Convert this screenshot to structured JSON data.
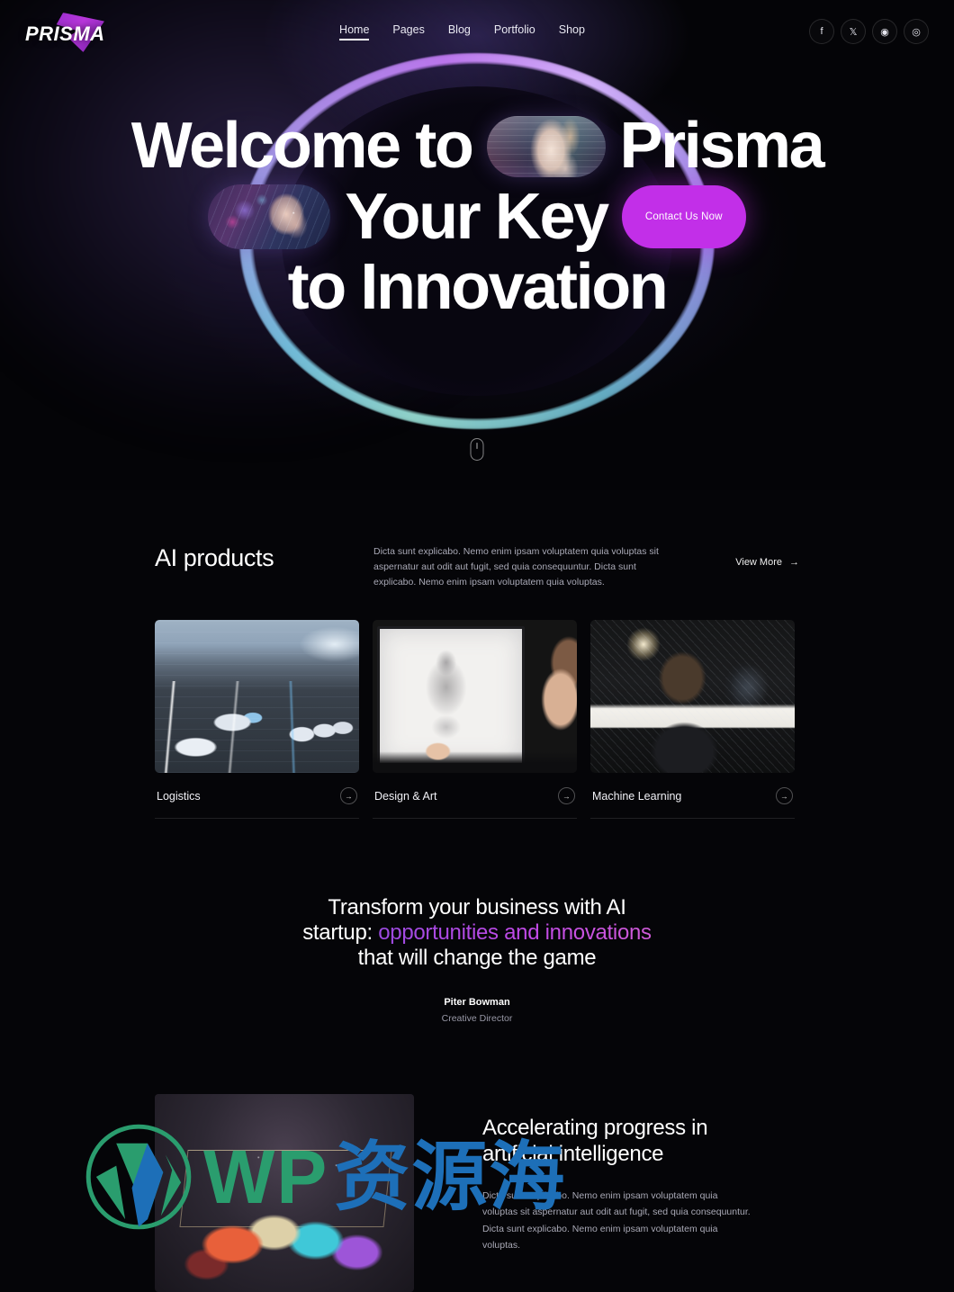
{
  "header": {
    "logo_text": "PRISMA",
    "nav": [
      {
        "label": "Home",
        "active": true
      },
      {
        "label": "Pages",
        "active": false
      },
      {
        "label": "Blog",
        "active": false
      },
      {
        "label": "Portfolio",
        "active": false
      },
      {
        "label": "Shop",
        "active": false
      }
    ],
    "socials": [
      {
        "name": "facebook-icon",
        "glyph": "f"
      },
      {
        "name": "x-twitter-icon",
        "glyph": "𝕏"
      },
      {
        "name": "dribbble-icon",
        "glyph": "◉"
      },
      {
        "name": "instagram-icon",
        "glyph": "◎"
      }
    ]
  },
  "hero": {
    "line1_a": "Welcome to",
    "line1_b": "Prisma",
    "line2": "Your Key",
    "line3": "to Innovation",
    "cta_label": "Contact Us Now",
    "cta_color": "#c22fe8",
    "image_1": "hand-glitch-image",
    "image_2": "cyborg-woman-image",
    "scroll_indicator": "mouse-scroll-icon"
  },
  "products": {
    "title": "AI products",
    "description": "Dicta sunt explicabo. Nemo enim ipsam voluptatem quia voluptas sit aspernatur aut odit aut fugit, sed quia consequuntur. Dicta sunt explicabo. Nemo enim ipsam voluptatem quia voluptas.",
    "view_more_label": "View More",
    "cards": [
      {
        "label": "Logistics",
        "image": "warehouse-trucks-image"
      },
      {
        "label": "Design & Art",
        "image": "digital-artist-tablet-image"
      },
      {
        "label": "Machine Learning",
        "image": "boy-at-monitor-image"
      }
    ]
  },
  "quote": {
    "line1": "Transform your business with AI",
    "line2_prefix": "startup: ",
    "line2_accent": "opportunities and innovations",
    "line3": "that will change the game",
    "accent_color": "#b24ae4",
    "author": "Piter Bowman",
    "role": "Creative Director"
  },
  "accelerating": {
    "heading_line1": "Accelerating progress in",
    "heading_line2": "artificial intelligence",
    "body": "Dicta sunt explicabo. Nemo enim ipsam voluptatem quia voluptas sit aspernatur aut odit aut fugit, sed quia consequuntur. Dicta sunt explicabo. Nemo enim ipsam voluptatem quia voluptas.",
    "image": "rainbow-cloud-cube-image"
  },
  "watermark": {
    "logo": "wordpress-logo",
    "text_en": "WP",
    "text_cn": "资源海"
  }
}
